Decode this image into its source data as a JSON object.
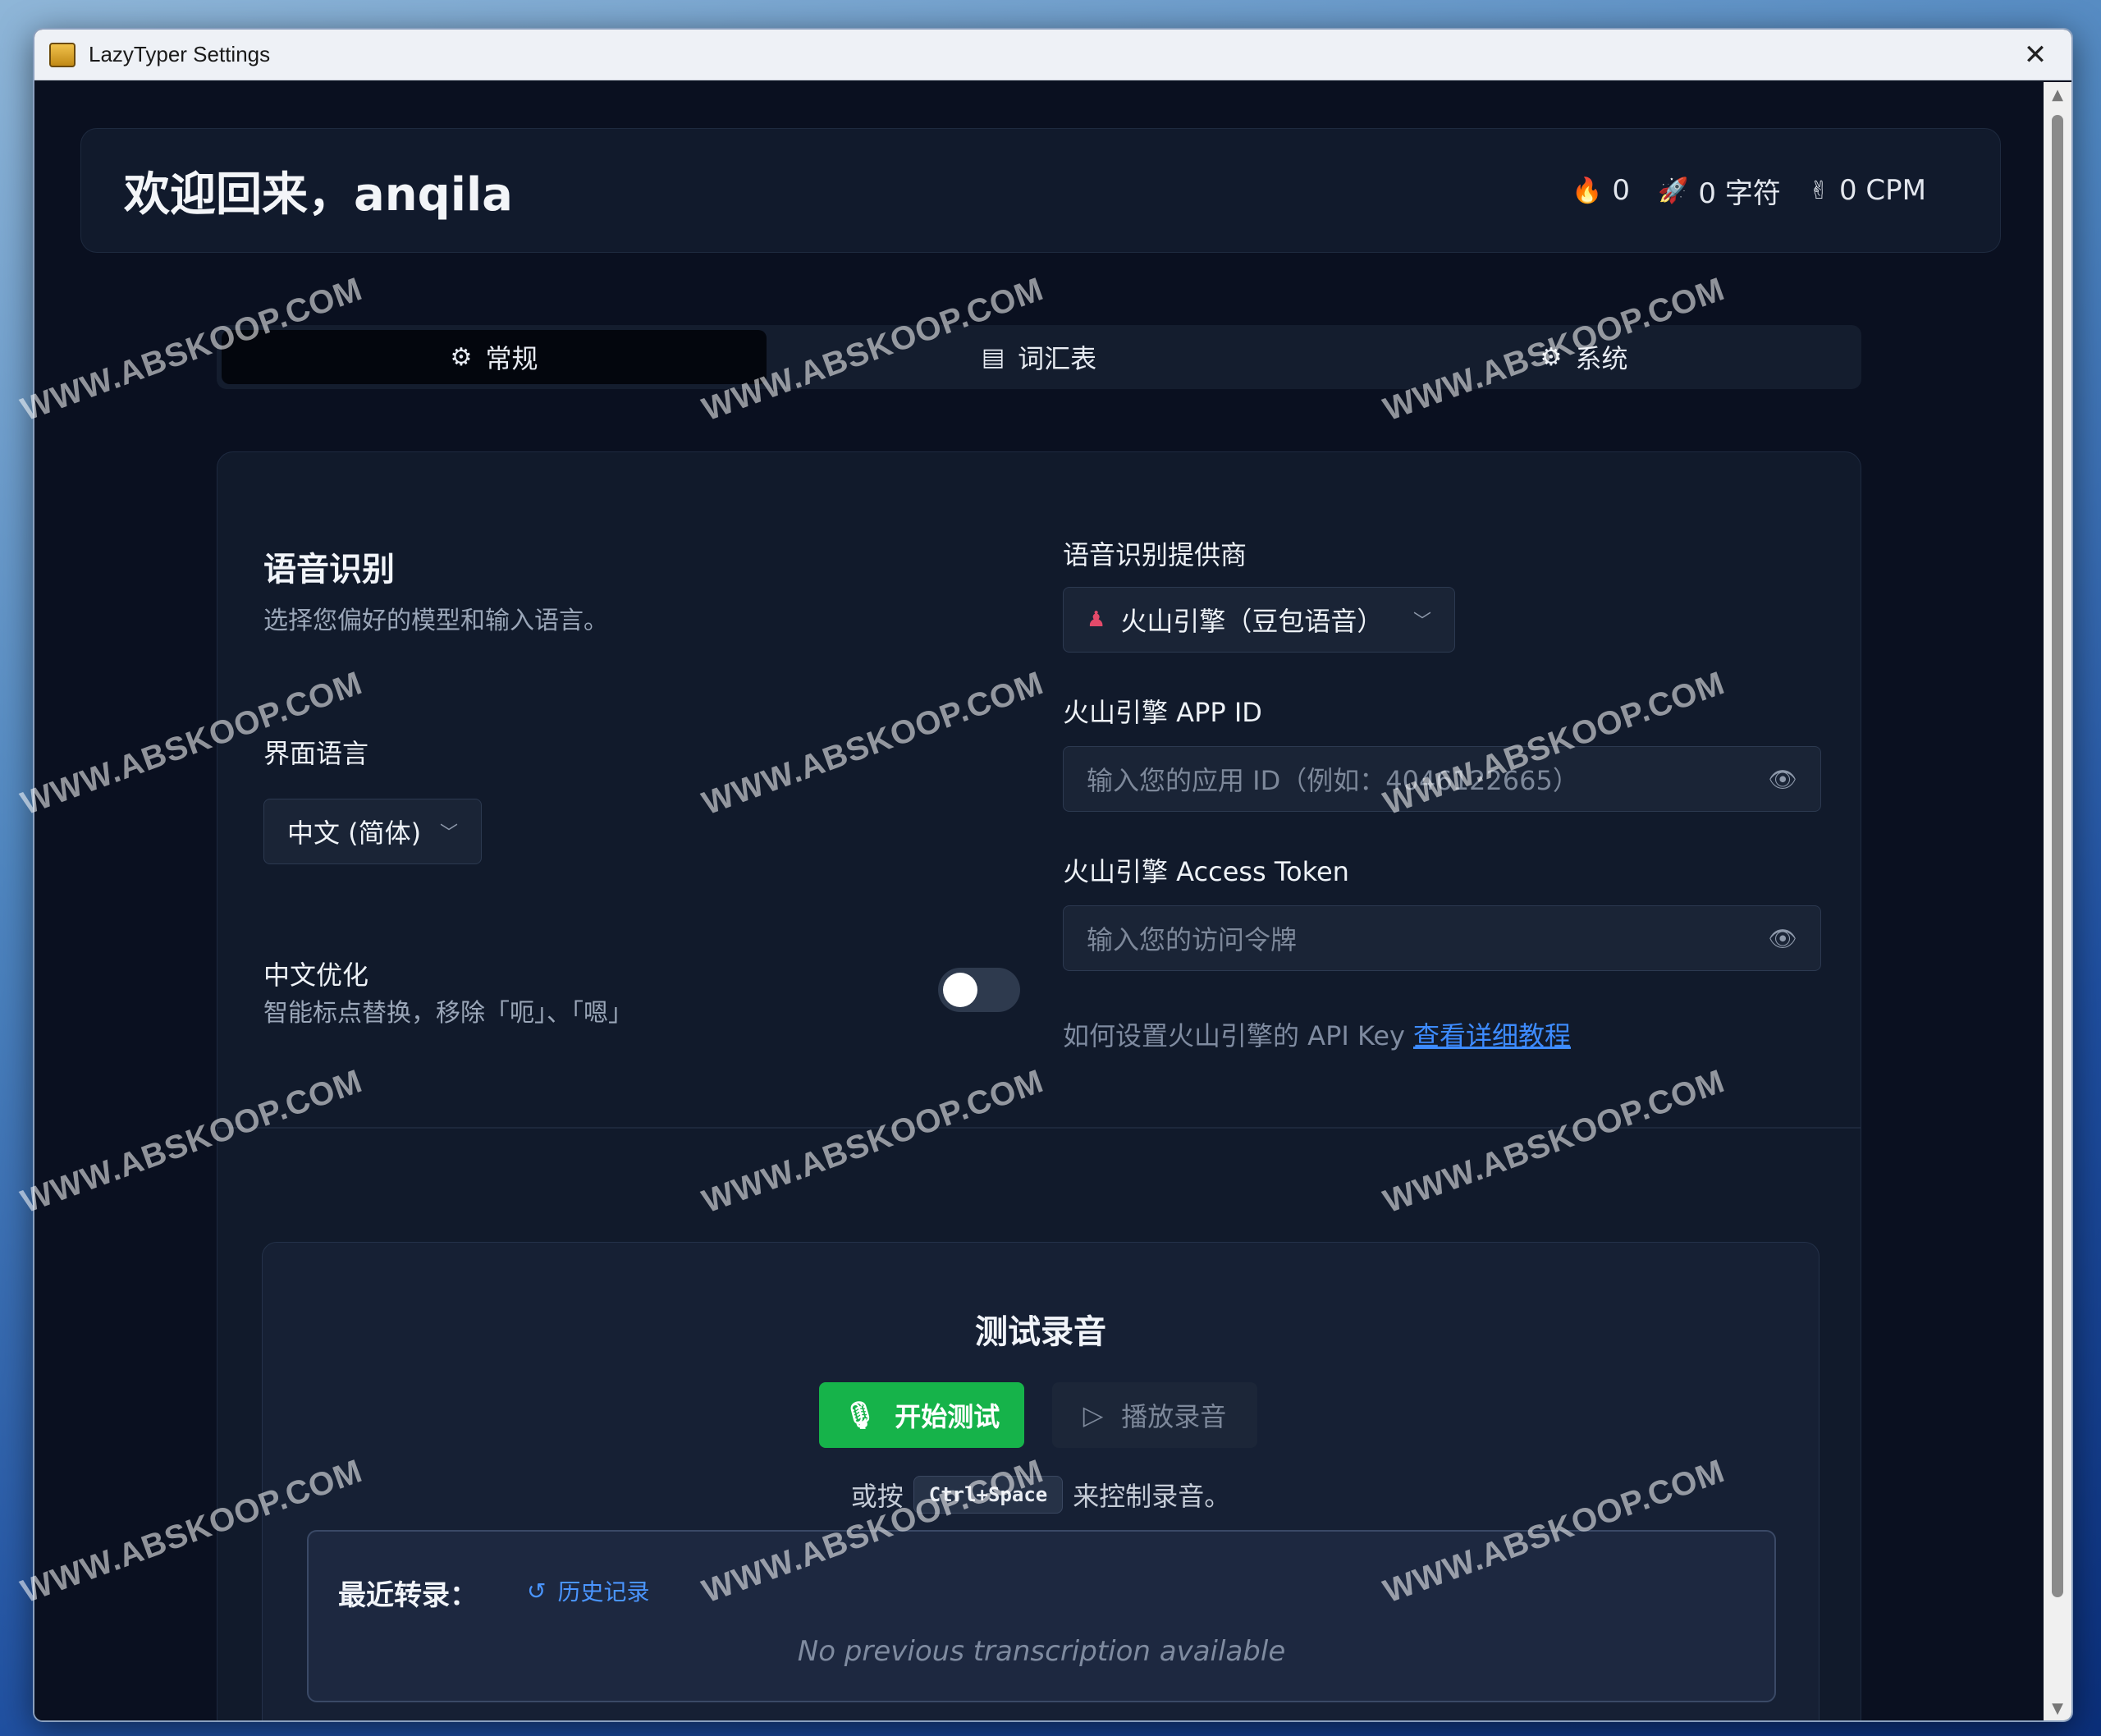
{
  "window": {
    "title": "LazyTyper Settings",
    "close": "✕"
  },
  "header": {
    "welcome": "欢迎回来，anqila",
    "stats": [
      {
        "icon": "fire-icon",
        "glyph": "🔥",
        "value": "0"
      },
      {
        "icon": "rocket-icon",
        "glyph": "🚀",
        "value": "0 字符"
      },
      {
        "icon": "hand-icon",
        "glyph": "✌",
        "value": "0 CPM"
      }
    ]
  },
  "tabs": [
    {
      "glyph": "⚙",
      "label": "常规",
      "active": true
    },
    {
      "glyph": "▤",
      "label": "词汇表",
      "active": false
    },
    {
      "glyph": "⚙",
      "label": "系统",
      "active": false
    }
  ],
  "speech": {
    "title": "语音识别",
    "desc": "选择您偏好的模型和输入语言。",
    "ui_lang_label": "界面语言",
    "ui_lang_value": "中文 (简体)",
    "cn_opt_label": "中文优化",
    "cn_opt_desc": "智能标点替换，移除「呃」、「嗯」",
    "cn_opt_on": false,
    "provider_label": "语音识别提供商",
    "provider_value": "火山引擎（豆包语音）",
    "appid_label": "火山引擎 APP ID",
    "appid_placeholder": "输入您的应用 ID（例如：4046122665）",
    "token_label": "火山引擎 Access Token",
    "token_placeholder": "输入您的访问令牌",
    "help_text": "如何设置火山引擎的 API Key",
    "help_link": "查看详细教程"
  },
  "test": {
    "title": "测试录音",
    "start_label": "开始测试",
    "play_label": "播放录音",
    "hint_prefix": "或按",
    "hint_key": "Ctrl+Space",
    "hint_suffix": "来控制录音。",
    "recent_label": "最近转录：",
    "history_label": "历史记录",
    "no_prev": "No previous transcription available"
  },
  "watermark": "WWW.ABSKOOP.COM",
  "colors": {
    "accent_green": "#16b34a",
    "link_blue": "#3d8bff",
    "background": "#0a1020"
  }
}
